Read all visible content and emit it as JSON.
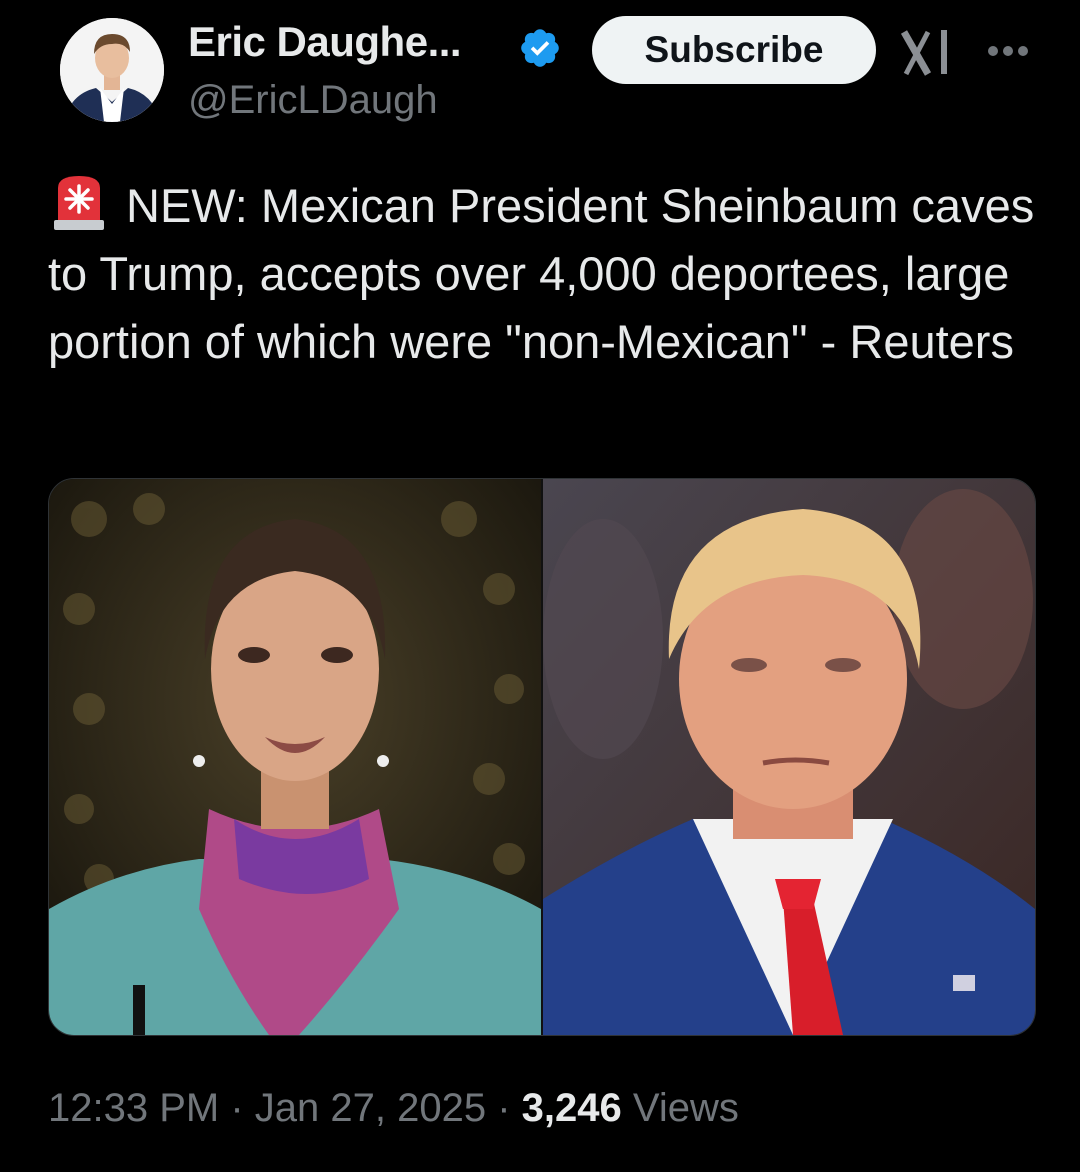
{
  "author": {
    "display_name": "Eric Daughe...",
    "handle": "@EricLDaugh",
    "verified_icon": "verified-badge-icon",
    "avatar": "avatar"
  },
  "header": {
    "subscribe_label": "Subscribe",
    "grok_icon": "grok-icon",
    "more_icon": "more-icon"
  },
  "tweet": {
    "emoji": "police-light-icon",
    "text": "NEW: Mexican President Sheinbaum caves to Trump, accepts over 4,000 deportees, large portion of which were \"non-Mexican\" - Reuters"
  },
  "meta": {
    "time": "12:33 PM",
    "date": "Jan 27, 2025",
    "separator": " · ",
    "views_count": "3,246",
    "views_label": "Views"
  },
  "colors": {
    "background": "#000000",
    "primary_text": "#e7e9ea",
    "secondary_text": "#71767b",
    "verified_blue": "#1d9bf0",
    "button_bg": "#eff3f4"
  }
}
